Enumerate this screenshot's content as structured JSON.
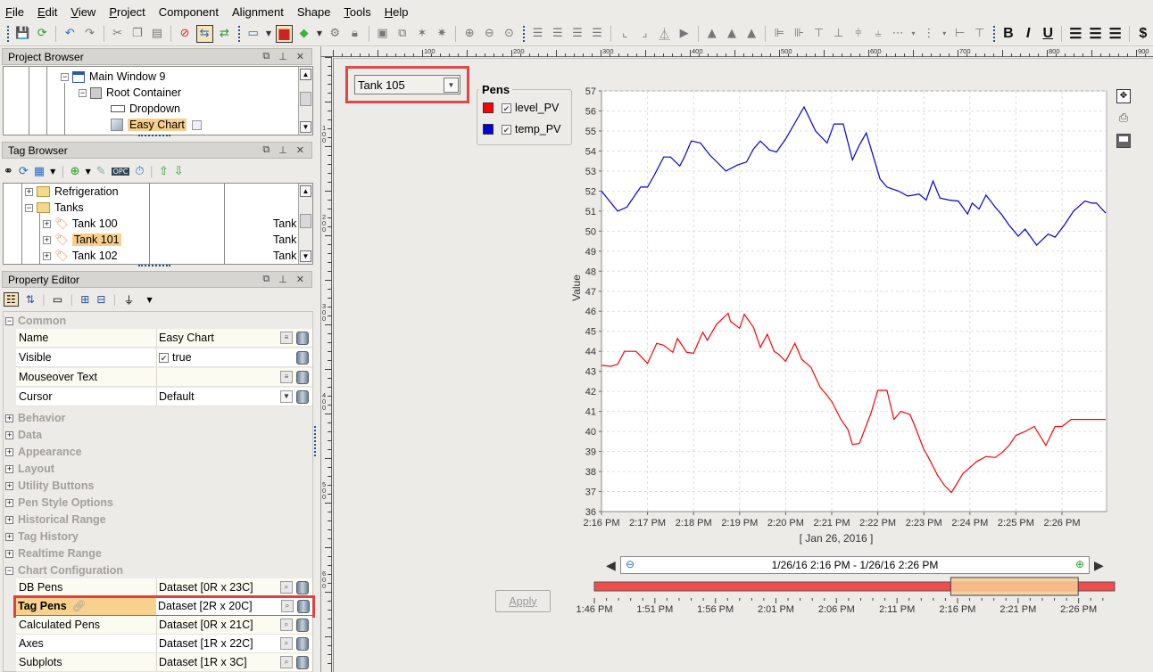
{
  "menubar": {
    "items": [
      {
        "label": "File",
        "mnemonic": "F",
        "rest": "ile"
      },
      {
        "label": "Edit",
        "mnemonic": "E",
        "rest": "dit"
      },
      {
        "label": "View",
        "mnemonic": "V",
        "rest": "iew"
      },
      {
        "label": "Project",
        "mnemonic": "P",
        "rest": "roject"
      },
      {
        "label": "Component",
        "mnemonic": "",
        "rest": "Component"
      },
      {
        "label": "Alignment",
        "mnemonic": "",
        "rest": "Alignment"
      },
      {
        "label": "Shape",
        "mnemonic": "",
        "rest": "Shape"
      },
      {
        "label": "Tools",
        "mnemonic": "T",
        "rest": "ools"
      },
      {
        "label": "Help",
        "mnemonic": "H",
        "rest": "elp"
      }
    ]
  },
  "toolbar": {
    "icons": [
      "save-publish-icon",
      "refresh-icon",
      "undo-icon",
      "redo-icon",
      "cut-icon",
      "copy-icon",
      "paste-icon",
      "comm-off-icon",
      "comm-read-icon",
      "comm-readwrite-icon",
      "new-window-icon",
      "stop-icon",
      "component-icon",
      "settings-icon",
      "lock-icon",
      "group-icon",
      "ungroup-icon",
      "zoom-in-icon",
      "zoom-out-icon",
      "zoom-actual-icon",
      "align-left-icon",
      "align-right-icon",
      "align-top-icon",
      "align-bottom-icon",
      "flip-icon",
      "rotate-icon",
      "shape-union-icon",
      "shape-diff-icon",
      "shape-intersect-icon"
    ],
    "format": {
      "bold": "B",
      "italic": "I",
      "underline": "U",
      "currency": "$"
    }
  },
  "project_browser": {
    "title": "Project Browser",
    "items": [
      {
        "label": "Main Window 9",
        "icon": "window-icon",
        "expander": "−"
      },
      {
        "label": "Root Container",
        "icon": "container-icon",
        "expander": "−"
      },
      {
        "label": "Dropdown",
        "icon": "dropdown-icon"
      },
      {
        "label": "Easy Chart",
        "icon": "chart-icon",
        "selected": true
      }
    ]
  },
  "tag_browser": {
    "title": "Tag Browser",
    "items": [
      {
        "label": "Refrigeration",
        "icon": "folder-icon",
        "expander": "+",
        "col3": ""
      },
      {
        "label": "Tanks",
        "icon": "folder-open-icon",
        "expander": "−",
        "col3": ""
      },
      {
        "label": "Tank 100",
        "icon": "tag-icon",
        "expander": "+",
        "col3": "Tank"
      },
      {
        "label": "Tank 101",
        "icon": "tag-icon",
        "expander": "+",
        "col3": "Tank",
        "selected": true
      },
      {
        "label": "Tank 102",
        "icon": "tag-icon",
        "expander": "+",
        "col3": "Tank"
      }
    ]
  },
  "property_editor": {
    "title": "Property Editor",
    "common": {
      "label": "Common",
      "rows": [
        {
          "name": "Name",
          "value": "Easy Chart"
        },
        {
          "name": "Visible",
          "value": "true",
          "checkbox": true
        },
        {
          "name": "Mouseover Text",
          "value": ""
        },
        {
          "name": "Cursor",
          "value": "Default",
          "dropdown": true
        }
      ]
    },
    "groups": [
      "Behavior",
      "Data",
      "Appearance",
      "Layout",
      "Utility Buttons",
      "Pen Style Options",
      "Historical Range",
      "Tag History",
      "Realtime Range"
    ],
    "chart_config": {
      "label": "Chart Configuration",
      "rows": [
        {
          "name": "DB Pens",
          "value": "Dataset [0R x 23C]"
        },
        {
          "name": "Tag Pens",
          "value": "Dataset [2R x 20C]",
          "highlighted": true
        },
        {
          "name": "Calculated Pens",
          "value": "Dataset [0R x 21C]"
        },
        {
          "name": "Axes",
          "value": "Dataset [1R x 22C]"
        },
        {
          "name": "Subplots",
          "value": "Dataset [1R x 3C]"
        }
      ]
    }
  },
  "ruler": {
    "h_labels": [
      "100",
      "200",
      "300",
      "400",
      "500",
      "600",
      "700",
      "800",
      "900"
    ],
    "v_labels": [
      "100",
      "200",
      "300",
      "400",
      "500",
      "600"
    ]
  },
  "dropdown": {
    "value": "Tank 105"
  },
  "pens": {
    "title": "Pens",
    "items": [
      {
        "label": "level_PV",
        "color": "#ff0000",
        "checked": true
      },
      {
        "label": "temp_PV",
        "color": "#0000dd",
        "checked": true
      }
    ]
  },
  "range_bar": {
    "text": "1/26/16 2:16 PM - 1/26/16 2:26 PM",
    "apply_label": "Apply",
    "ticks": [
      "1:46 PM",
      "1:51 PM",
      "1:56 PM",
      "2:01 PM",
      "2:06 PM",
      "2:11 PM",
      "2:16 PM",
      "2:21 PM",
      "2:26 PM"
    ],
    "selection_start_fraction": 0.685,
    "selection_end_fraction": 0.93
  },
  "chart_data": {
    "type": "line",
    "title": "",
    "xlabel": "[ Jan 26, 2016 ]",
    "ylabel": "Value",
    "ylim": [
      36,
      57
    ],
    "xlim_minutes_after_216pm": [
      0,
      10.95
    ],
    "grid": true,
    "legend": "none",
    "x_tick_labels": [
      "2:16 PM",
      "2:17 PM",
      "2:18 PM",
      "2:19 PM",
      "2:20 PM",
      "2:21 PM",
      "2:22 PM",
      "2:23 PM",
      "2:24 PM",
      "2:25 PM",
      "2:26 PM"
    ],
    "y_tick_labels": [
      "36",
      "37",
      "38",
      "39",
      "40",
      "41",
      "42",
      "43",
      "44",
      "45",
      "46",
      "47",
      "48",
      "49",
      "50",
      "51",
      "52",
      "53",
      "54",
      "55",
      "56",
      "57"
    ],
    "series": [
      {
        "name": "level_PV",
        "color": "#ff0000",
        "x": [
          0,
          0.2,
          0.35,
          0.5,
          0.75,
          1.0,
          1.2,
          1.35,
          1.55,
          1.65,
          1.85,
          2.0,
          2.2,
          2.3,
          2.5,
          2.75,
          2.8,
          3.0,
          3.1,
          3.3,
          3.45,
          3.6,
          3.75,
          3.85,
          4.0,
          4.2,
          4.35,
          4.55,
          4.75,
          4.9,
          5.0,
          5.2,
          5.35,
          5.45,
          5.6,
          5.75,
          5.85,
          6.0,
          6.2,
          6.35,
          6.5,
          6.7,
          6.8,
          7.0,
          7.1,
          7.3,
          7.45,
          7.6,
          7.85,
          8.0,
          8.15,
          8.35,
          8.55,
          8.7,
          8.85,
          9.0,
          9.2,
          9.4,
          9.65,
          9.85,
          10.0,
          10.2,
          10.35,
          10.55,
          10.65,
          10.75,
          10.95
        ],
        "y": [
          43.3,
          43.25,
          43.35,
          44.0,
          44.0,
          43.4,
          44.4,
          44.3,
          43.95,
          44.65,
          43.95,
          43.9,
          44.95,
          44.55,
          45.35,
          45.9,
          45.5,
          45.15,
          45.85,
          45.2,
          44.2,
          44.85,
          44.0,
          43.85,
          43.5,
          44.4,
          43.6,
          43.2,
          42.2,
          41.8,
          41.5,
          40.6,
          40.1,
          39.35,
          39.4,
          40.3,
          40.9,
          42.05,
          42.05,
          40.6,
          41.0,
          40.85,
          40.3,
          39.1,
          38.7,
          37.8,
          37.3,
          36.95,
          37.9,
          38.2,
          38.5,
          38.75,
          38.7,
          38.95,
          39.3,
          39.8,
          40.0,
          40.25,
          39.3,
          40.25,
          40.25,
          40.6,
          40.6,
          40.6,
          40.6,
          40.6,
          40.6
        ]
      },
      {
        "name": "temp_PV",
        "color": "#0000dd",
        "x": [
          0,
          0.35,
          0.55,
          0.85,
          1.0,
          1.15,
          1.35,
          1.5,
          1.7,
          1.8,
          1.95,
          2.15,
          2.35,
          2.55,
          2.7,
          2.95,
          3.15,
          3.3,
          3.45,
          3.65,
          3.8,
          4.0,
          4.2,
          4.4,
          4.65,
          4.9,
          5.05,
          5.25,
          5.45,
          5.6,
          5.75,
          6.05,
          6.2,
          6.45,
          6.65,
          6.9,
          7.05,
          7.2,
          7.35,
          7.55,
          7.75,
          7.95,
          8.05,
          8.2,
          8.35,
          8.55,
          8.7,
          8.85,
          9.05,
          9.2,
          9.45,
          9.7,
          9.85,
          10.05,
          10.25,
          10.5,
          10.65,
          10.75,
          10.95
        ],
        "y": [
          52.0,
          51.0,
          51.2,
          52.2,
          52.2,
          52.8,
          53.7,
          53.7,
          53.25,
          53.7,
          54.5,
          54.4,
          53.8,
          53.35,
          53.0,
          53.3,
          53.45,
          54.1,
          54.5,
          54.05,
          53.95,
          54.6,
          55.4,
          56.2,
          55.0,
          54.4,
          55.35,
          55.35,
          53.55,
          54.3,
          54.9,
          52.6,
          52.2,
          52.0,
          51.75,
          51.85,
          51.55,
          52.5,
          51.65,
          51.55,
          51.5,
          50.85,
          51.4,
          51.1,
          51.8,
          51.2,
          50.8,
          50.3,
          49.75,
          50.1,
          49.3,
          49.85,
          49.7,
          50.3,
          51.0,
          51.5,
          51.4,
          51.4,
          50.9
        ]
      }
    ]
  }
}
